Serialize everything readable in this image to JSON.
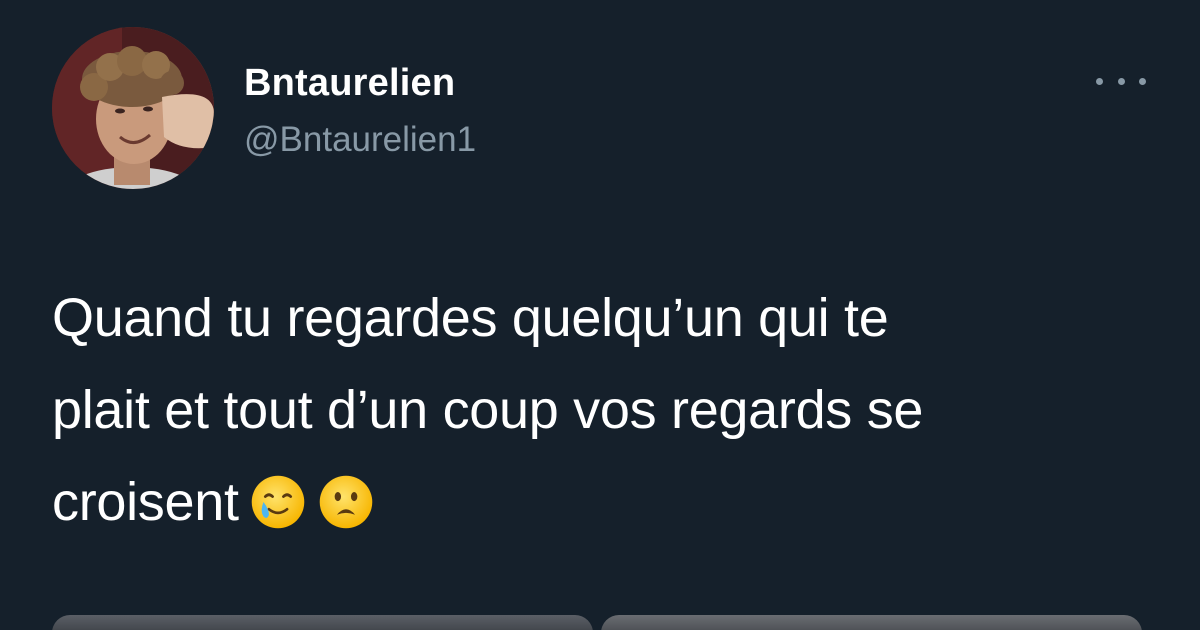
{
  "tweet": {
    "author": {
      "display_name": "Bntaurelien",
      "handle": "@Bntaurelien1",
      "avatar_icon": "profile-photo"
    },
    "more_icon": "more-horizontal-icon",
    "text_lines": [
      "Quand tu regardes quelqu’un qui te",
      "plait et tout d’un coup vos regards se",
      "croisent"
    ],
    "emojis": [
      "smiling-face-with-tear-icon",
      "frowning-face-with-open-mouth-icon"
    ],
    "media_count": 2
  },
  "colors": {
    "background": "#15202b",
    "primary_text": "#ffffff",
    "secondary_text": "#8899a6"
  }
}
